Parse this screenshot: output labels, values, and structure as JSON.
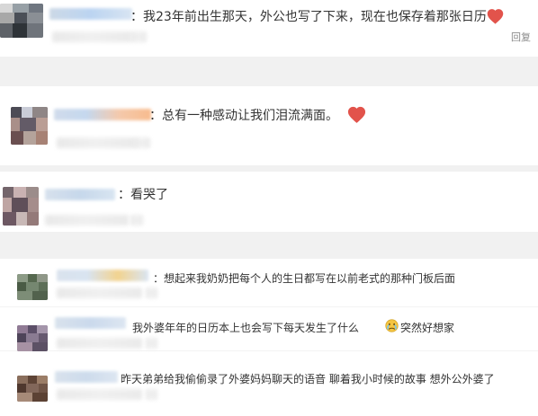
{
  "comments": [
    {
      "text": "：我23年前出生那天，外公也写了下来，现在也保存着那张日历",
      "emoji": "heart",
      "reply_label": "回复"
    },
    {
      "text": "：总有一种感动让我们泪流满面。",
      "emoji": "heart"
    },
    {
      "text": "：看哭了"
    },
    {
      "text": "：想起来我奶奶把每个人的生日都写在以前老式的那种门板后面"
    },
    {
      "text_before": "我外婆年年的日历本上也会写下每天发生了什么",
      "emoji": "crying-face",
      "text_after": "突然好想家"
    },
    {
      "text": "昨天弟弟给我偷偷录了外婆妈妈聊天的语音 聊着我小时候的故事 想外公外婆了"
    }
  ],
  "colors": {
    "background": "#ffffff",
    "separator": "#f1f1f1",
    "text": "#333333",
    "reply": "#8a8a8a",
    "heart": "#e2534b",
    "emoji": "#f5c542"
  }
}
